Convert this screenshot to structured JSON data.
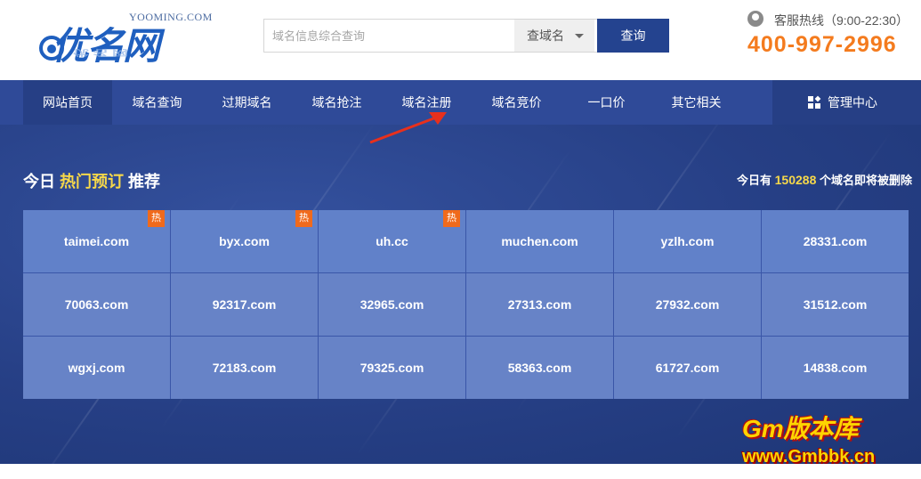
{
  "logo": {
    "en": "YOOMING.COM",
    "cn": "优名网"
  },
  "search": {
    "placeholder": "域名信息综合查询",
    "select_value": "查域名",
    "button_label": "查询"
  },
  "hotline": {
    "label": "客服热线（9:00-22:30）",
    "number": "400-997-2996"
  },
  "nav": {
    "items": [
      {
        "label": "网站首页",
        "active": true
      },
      {
        "label": "域名查询"
      },
      {
        "label": "过期域名"
      },
      {
        "label": "域名抢注"
      },
      {
        "label": "域名注册"
      },
      {
        "label": "域名竞价"
      },
      {
        "label": "一口价"
      },
      {
        "label": "其它相关"
      }
    ],
    "admin_label": "管理中心"
  },
  "section": {
    "title_prefix": "今日",
    "title_highlight": "热门预订",
    "title_suffix": "推荐",
    "count_prefix": "今日有",
    "count_value": "150288",
    "count_suffix": "个域名即将被删除"
  },
  "hot_badge": "热",
  "domains": [
    {
      "name": "taimei.com",
      "hot": true
    },
    {
      "name": "byx.com",
      "hot": true
    },
    {
      "name": "uh.cc",
      "hot": true
    },
    {
      "name": "muchen.com"
    },
    {
      "name": "yzlh.com"
    },
    {
      "name": "28331.com"
    },
    {
      "name": "70063.com"
    },
    {
      "name": "92317.com"
    },
    {
      "name": "32965.com"
    },
    {
      "name": "27313.com"
    },
    {
      "name": "27932.com"
    },
    {
      "name": "31512.com"
    },
    {
      "name": "wgxj.com"
    },
    {
      "name": "72183.com"
    },
    {
      "name": "79325.com"
    },
    {
      "name": "58363.com"
    },
    {
      "name": "61727.com"
    },
    {
      "name": "14838.com"
    }
  ],
  "watermark": {
    "top": "Gm版本库",
    "bottom": "www.Gmbbk.cn"
  },
  "colors": {
    "nav_bg": "#2f4a98",
    "accent_orange": "#f47b1e",
    "highlight_yellow": "#f6d84a",
    "search_button": "#24438f"
  }
}
